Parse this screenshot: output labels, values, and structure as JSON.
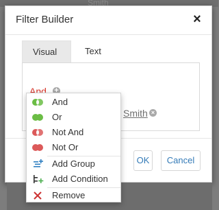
{
  "background": {
    "ghost_text": "Smith"
  },
  "dialog": {
    "title": "Filter Builder",
    "close_glyph": "×",
    "tabs": [
      {
        "label": "Visual",
        "active": true
      },
      {
        "label": "Text",
        "active": false
      }
    ],
    "group_operation": "And",
    "add_glyph": "+",
    "remove_glyph": "×",
    "condition_value": "Smith",
    "buttons": {
      "ok": "OK",
      "cancel": "Cancel"
    }
  },
  "menu": {
    "items": [
      {
        "label": "And",
        "icon": "and-operator-icon"
      },
      {
        "label": "Or",
        "icon": "or-operator-icon"
      },
      {
        "label": "Not And",
        "icon": "not-and-operator-icon"
      },
      {
        "label": "Not Or",
        "icon": "not-or-operator-icon"
      },
      {
        "label": "Add Group",
        "icon": "add-group-icon"
      },
      {
        "label": "Add Condition",
        "icon": "add-condition-icon"
      },
      {
        "label": "Remove",
        "icon": "remove-icon"
      }
    ]
  },
  "colors": {
    "accent_red": "#d9362b",
    "link_blue": "#337ab7",
    "and_green": "#6bbd45",
    "not_red": "#dc5a5a",
    "add_icon_blue": "#2f7fc1",
    "add_condition_green": "#4caf50",
    "remove_red": "#cc3333"
  }
}
